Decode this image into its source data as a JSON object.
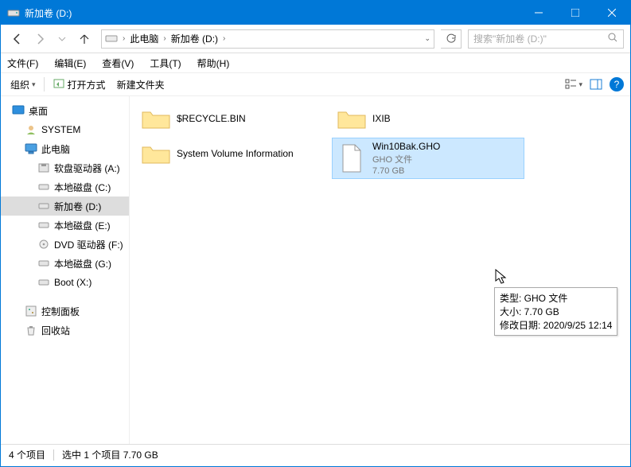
{
  "title": "新加卷 (D:)",
  "breadcrumb": {
    "c0": "此电脑",
    "c1": "新加卷 (D:)"
  },
  "search_placeholder": "搜索\"新加卷 (D:)\"",
  "menu": {
    "file": "文件(F)",
    "edit": "编辑(E)",
    "view": "查看(V)",
    "tools": "工具(T)",
    "help": "帮助(H)"
  },
  "toolbar": {
    "organize": "组织",
    "open_with": "打开方式",
    "new_folder": "新建文件夹"
  },
  "tree": {
    "desktop": "桌面",
    "system": "SYSTEM",
    "thispc": "此电脑",
    "floppy": "软盘驱动器 (A:)",
    "localc": "本地磁盘 (C:)",
    "newvold": "新加卷 (D:)",
    "locale": "本地磁盘 (E:)",
    "dvd": "DVD 驱动器 (F:)",
    "localg": "本地磁盘 (G:)",
    "boot": "Boot (X:)",
    "ctrl": "控制面板",
    "recycle": "回收站"
  },
  "files": {
    "recycle": "$RECYCLE.BIN",
    "ixib": "IXIB",
    "svi": "System Volume Information",
    "gho": {
      "name": "Win10Bak.GHO",
      "type": "GHO 文件",
      "size": "7.70 GB"
    }
  },
  "tooltip": {
    "l1": "类型: GHO 文件",
    "l2": "大小: 7.70 GB",
    "l3": "修改日期: 2020/9/25 12:14"
  },
  "status": {
    "count": "4 个项目",
    "selection": "选中 1 个项目 7.70 GB"
  }
}
